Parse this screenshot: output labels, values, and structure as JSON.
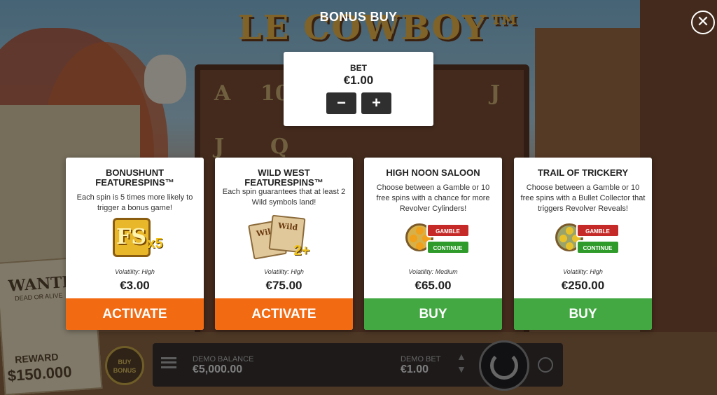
{
  "dialog": {
    "title": "BONUS BUY",
    "close_icon": "close-icon"
  },
  "bet": {
    "label": "BET",
    "value": "€1.00",
    "decrease_label": "−",
    "increase_label": "+"
  },
  "cards": [
    {
      "title": "BONUSHUNT FEATURESPINS™",
      "description": "Each spin is 5 times more likely to trigger a bonus game!",
      "image_text": "FS",
      "image_badge": "x5",
      "volatility": "Volatility: High",
      "price": "€3.00",
      "button": "ACTIVATE",
      "button_color": "#f26a12"
    },
    {
      "title": "WILD WEST FEATURESPINS™",
      "description": "Each spin guarantees that at least 2 Wild symbols land!",
      "image_text": "Wild",
      "image_badge": "2+",
      "volatility": "Volatility: High",
      "price": "€75.00",
      "button": "ACTIVATE",
      "button_color": "#f26a12"
    },
    {
      "title": "HIGH NOON SALOON",
      "description": "Choose between a Gamble or 10 free spins with a chance for more Revolver Cylinders!",
      "image_gamble": "GAMBLE",
      "image_continue": "CONTINUE",
      "volatility": "Volatility: Medium",
      "price": "€65.00",
      "button": "BUY",
      "button_color": "#43a842"
    },
    {
      "title": "TRAIL OF TRICKERY",
      "description": "Choose between a Gamble or 10 free spins with a Bullet Collector that triggers Revolver Reveals!",
      "image_gamble": "GAMBLE",
      "image_continue": "CONTINUE",
      "volatility": "Volatility: High",
      "price": "€250.00",
      "button": "BUY",
      "button_color": "#43a842"
    }
  ],
  "background": {
    "logo": "LE COWBOY™",
    "wanted_title": "WANTED",
    "wanted_sub": "DEAD OR ALIVE",
    "wanted_reward": "REWARD",
    "wanted_amount": "$150.000",
    "buy_bonus": "BUY BONUS",
    "demo_balance_label": "DEMO BALANCE",
    "demo_balance_value": "€5,000.00",
    "demo_bet_label": "DEMO BET",
    "demo_bet_value": "€1.00",
    "reel_symbols": [
      "A",
      "10",
      "J",
      "J",
      "Q"
    ]
  }
}
